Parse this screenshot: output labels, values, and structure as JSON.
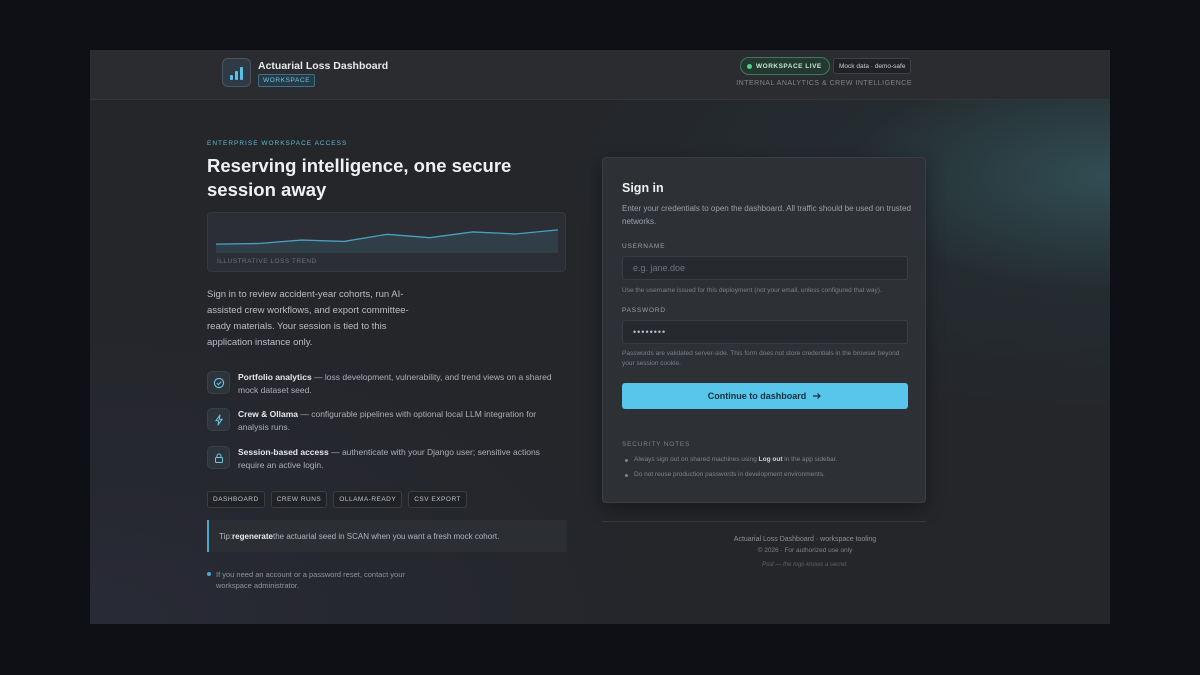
{
  "header": {
    "app_title": "Actuarial Loss Dashboard",
    "app_badge": "WORKSPACE",
    "status_pill": "WORKSPACE LIVE",
    "mock_pill": "Mock data · demo-safe",
    "subtitle": "INTERNAL ANALYTICS & CREW INTELLIGENCE"
  },
  "hero": {
    "eyebrow": "ENTERPRISE WORKSPACE ACCESS",
    "headline": "Reserving intelligence, one secure session away",
    "chart_caption": "ILLUSTRATIVE LOSS TREND",
    "intro": "Sign in to review accident-year cohorts, run AI-assisted crew workflows, and export committee-ready materials. Your session is tied to this application instance only."
  },
  "chart_data": {
    "type": "area",
    "x": [
      1,
      2,
      3,
      4,
      5,
      6,
      7,
      8,
      9
    ],
    "values": [
      0.26,
      0.28,
      0.38,
      0.34,
      0.55,
      0.45,
      0.62,
      0.56,
      0.68
    ],
    "ylim": [
      0,
      1
    ],
    "title": "ILLUSTRATIVE LOSS TREND",
    "grid": false
  },
  "features": [
    {
      "icon": "check-circle-icon",
      "title": "Portfolio analytics",
      "text": " — loss development, vulnerability, and trend views on a shared mock dataset seed."
    },
    {
      "icon": "lightning-icon",
      "title": "Crew & Ollama",
      "text": " — configurable pipelines with optional local LLM integration for analysis runs."
    },
    {
      "icon": "lock-icon",
      "title": "Session-based access",
      "text": " — authenticate with your Django user; sensitive actions require an active login."
    }
  ],
  "tags": [
    "DASHBOARD",
    "CREW RUNS",
    "OLLAMA-READY",
    "CSV EXPORT"
  ],
  "tip": {
    "prefix": "Tip:",
    "bold": "regenerate",
    "text": "the actuarial seed in SCAN when you want a fresh mock cohort."
  },
  "contact": "If you need an account or a password reset, contact your workspace administrator.",
  "signin": {
    "title": "Sign in",
    "description": "Enter your credentials to open the dashboard. All traffic should be used on trusted networks.",
    "username_label": "USERNAME",
    "username_placeholder": "e.g. jane.doe",
    "username_help": "Use the username issued for this deployment (not your email, unless configured that way).",
    "password_label": "PASSWORD",
    "password_value": "••••••••",
    "password_help": "Passwords are validated server-side. This form does not store credentials in the browser beyond your session cookie.",
    "button_label": "Continue to dashboard",
    "button_icon": "arrow-right-icon",
    "notes_title": "SECURITY NOTES",
    "note_1_before": "Always sign out on shared machines using ",
    "note_1_bold": "Log out",
    "note_1_after": " in the app sidebar.",
    "note_2": "Do not reuse production passwords in development environments."
  },
  "footer": {
    "line1": "Actuarial Loss Dashboard · workspace tooling",
    "line2": "© 2026 · For authorized use only",
    "line3": "Psst — the logo knows a secret."
  },
  "colors": {
    "accent": "#58c6ea",
    "live": "#4ed18c",
    "background": "#24262a"
  }
}
